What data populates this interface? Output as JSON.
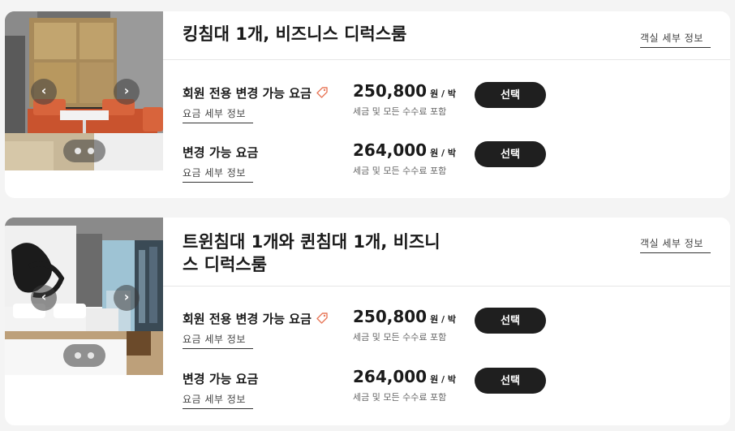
{
  "rooms": [
    {
      "title": "킹침대 1개, 비즈니스 디럭스룸",
      "details_label": "객실 세부 정보",
      "photo_icon": "hotel-room-photo",
      "prev_icon": "chevron-left-icon",
      "next_icon": "chevron-right-icon",
      "prev_glyph": "‹",
      "next_glyph": "›",
      "rates": [
        {
          "name": "회원 전용 변경 가능 요금",
          "has_tag_icon": true,
          "details_label": "요금 세부 정보",
          "price": "250,800",
          "unit": "원 / 박",
          "note": "세금 및 모든 수수료 포함",
          "button_label": "선택"
        },
        {
          "name": "변경 가능 요금",
          "has_tag_icon": false,
          "details_label": "요금 세부 정보",
          "price": "264,000",
          "unit": "원 / 박",
          "note": "세금 및 모든 수수료 포함",
          "button_label": "선택"
        }
      ]
    },
    {
      "title": "트윈침대 1개와 퀸침대 1개, 비즈니스 디럭스룸",
      "details_label": "객실 세부 정보",
      "photo_icon": "hotel-room-photo",
      "prev_icon": "chevron-left-icon",
      "next_icon": "chevron-right-icon",
      "prev_glyph": "‹",
      "next_glyph": "›",
      "rates": [
        {
          "name": "회원 전용 변경 가능 요금",
          "has_tag_icon": true,
          "details_label": "요금 세부 정보",
          "price": "250,800",
          "unit": "원 / 박",
          "note": "세금 및 모든 수수료 포함",
          "button_label": "선택"
        },
        {
          "name": "변경 가능 요금",
          "has_tag_icon": false,
          "details_label": "요금 세부 정보",
          "price": "264,000",
          "unit": "원 / 박",
          "note": "세금 및 모든 수수료 포함",
          "button_label": "선택"
        }
      ]
    }
  ],
  "colors": {
    "button_bg": "#1f1f1f",
    "tag_icon": "#e8785a",
    "sofa": "#c9532e"
  }
}
